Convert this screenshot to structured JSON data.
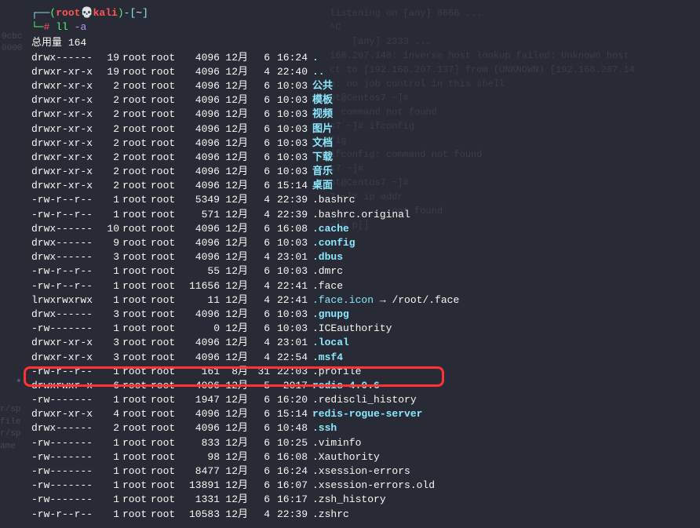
{
  "prompt": {
    "user": "root",
    "host": "kali",
    "path": "~",
    "command": "ll",
    "args": "-a"
  },
  "total_label": "总用量",
  "total_value": "164",
  "rows": [
    {
      "perms": "drwx------",
      "links": "19",
      "owner": "root",
      "group": "root",
      "size": "4096",
      "month": "12月",
      "day": "6",
      "time": "16:24",
      "name": ".",
      "type": "dir"
    },
    {
      "perms": "drwxr-xr-x",
      "links": "19",
      "owner": "root",
      "group": "root",
      "size": "4096",
      "month": "12月",
      "day": "4",
      "time": "22:40",
      "name": "..",
      "type": "dir"
    },
    {
      "perms": "drwxr-xr-x",
      "links": "2",
      "owner": "root",
      "group": "root",
      "size": "4096",
      "month": "12月",
      "day": "6",
      "time": "10:03",
      "name": "公共",
      "type": "dir"
    },
    {
      "perms": "drwxr-xr-x",
      "links": "2",
      "owner": "root",
      "group": "root",
      "size": "4096",
      "month": "12月",
      "day": "6",
      "time": "10:03",
      "name": "模板",
      "type": "dir"
    },
    {
      "perms": "drwxr-xr-x",
      "links": "2",
      "owner": "root",
      "group": "root",
      "size": "4096",
      "month": "12月",
      "day": "6",
      "time": "10:03",
      "name": "视频",
      "type": "dir"
    },
    {
      "perms": "drwxr-xr-x",
      "links": "2",
      "owner": "root",
      "group": "root",
      "size": "4096",
      "month": "12月",
      "day": "6",
      "time": "10:03",
      "name": "图片",
      "type": "dir"
    },
    {
      "perms": "drwxr-xr-x",
      "links": "2",
      "owner": "root",
      "group": "root",
      "size": "4096",
      "month": "12月",
      "day": "6",
      "time": "10:03",
      "name": "文档",
      "type": "dir"
    },
    {
      "perms": "drwxr-xr-x",
      "links": "2",
      "owner": "root",
      "group": "root",
      "size": "4096",
      "month": "12月",
      "day": "6",
      "time": "10:03",
      "name": "下载",
      "type": "dir"
    },
    {
      "perms": "drwxr-xr-x",
      "links": "2",
      "owner": "root",
      "group": "root",
      "size": "4096",
      "month": "12月",
      "day": "6",
      "time": "10:03",
      "name": "音乐",
      "type": "dir"
    },
    {
      "perms": "drwxr-xr-x",
      "links": "2",
      "owner": "root",
      "group": "root",
      "size": "4096",
      "month": "12月",
      "day": "6",
      "time": "15:14",
      "name": "桌面",
      "type": "dir"
    },
    {
      "perms": "-rw-r--r--",
      "links": "1",
      "owner": "root",
      "group": "root",
      "size": "5349",
      "month": "12月",
      "day": "4",
      "time": "22:39",
      "name": ".bashrc",
      "type": "file"
    },
    {
      "perms": "-rw-r--r--",
      "links": "1",
      "owner": "root",
      "group": "root",
      "size": "571",
      "month": "12月",
      "day": "4",
      "time": "22:39",
      "name": ".bashrc.original",
      "type": "file"
    },
    {
      "perms": "drwx------",
      "links": "10",
      "owner": "root",
      "group": "root",
      "size": "4096",
      "month": "12月",
      "day": "6",
      "time": "16:08",
      "name": ".cache",
      "type": "dir"
    },
    {
      "perms": "drwx------",
      "links": "9",
      "owner": "root",
      "group": "root",
      "size": "4096",
      "month": "12月",
      "day": "6",
      "time": "10:03",
      "name": ".config",
      "type": "dir"
    },
    {
      "perms": "drwx------",
      "links": "3",
      "owner": "root",
      "group": "root",
      "size": "4096",
      "month": "12月",
      "day": "4",
      "time": "23:01",
      "name": ".dbus",
      "type": "dir"
    },
    {
      "perms": "-rw-r--r--",
      "links": "1",
      "owner": "root",
      "group": "root",
      "size": "55",
      "month": "12月",
      "day": "6",
      "time": "10:03",
      "name": ".dmrc",
      "type": "file"
    },
    {
      "perms": "-rw-r--r--",
      "links": "1",
      "owner": "root",
      "group": "root",
      "size": "11656",
      "month": "12月",
      "day": "4",
      "time": "22:41",
      "name": ".face",
      "type": "file"
    },
    {
      "perms": "lrwxrwxrwx",
      "links": "1",
      "owner": "root",
      "group": "root",
      "size": "11",
      "month": "12月",
      "day": "4",
      "time": "22:41",
      "name": ".face.icon",
      "type": "link",
      "target": "/root/.face"
    },
    {
      "perms": "drwx------",
      "links": "3",
      "owner": "root",
      "group": "root",
      "size": "4096",
      "month": "12月",
      "day": "6",
      "time": "10:03",
      "name": ".gnupg",
      "type": "dir"
    },
    {
      "perms": "-rw-------",
      "links": "1",
      "owner": "root",
      "group": "root",
      "size": "0",
      "month": "12月",
      "day": "6",
      "time": "10:03",
      "name": ".ICEauthority",
      "type": "file"
    },
    {
      "perms": "drwxr-xr-x",
      "links": "3",
      "owner": "root",
      "group": "root",
      "size": "4096",
      "month": "12月",
      "day": "4",
      "time": "23:01",
      "name": ".local",
      "type": "dir"
    },
    {
      "perms": "drwxr-xr-x",
      "links": "3",
      "owner": "root",
      "group": "root",
      "size": "4096",
      "month": "12月",
      "day": "4",
      "time": "22:54",
      "name": ".msf4",
      "type": "dir"
    },
    {
      "perms": "-rw-r--r--",
      "links": "1",
      "owner": "root",
      "group": "root",
      "size": "161",
      "month": "8月",
      "day": "31",
      "time": "22:03",
      "name": ".profile",
      "type": "file"
    },
    {
      "perms": "drwxrwxr-x",
      "links": "6",
      "owner": "root",
      "group": "root",
      "size": "4096",
      "month": "12月",
      "day": "5",
      "time": "2017",
      "name": "redis-4.0.6",
      "type": "dir"
    },
    {
      "perms": "-rw-------",
      "links": "1",
      "owner": "root",
      "group": "root",
      "size": "1947",
      "month": "12月",
      "day": "6",
      "time": "16:20",
      "name": ".rediscli_history",
      "type": "file"
    },
    {
      "perms": "drwxr-xr-x",
      "links": "4",
      "owner": "root",
      "group": "root",
      "size": "4096",
      "month": "12月",
      "day": "6",
      "time": "15:14",
      "name": "redis-rogue-server",
      "type": "dir"
    },
    {
      "perms": "drwx------",
      "links": "2",
      "owner": "root",
      "group": "root",
      "size": "4096",
      "month": "12月",
      "day": "6",
      "time": "10:48",
      "name": ".ssh",
      "type": "dir"
    },
    {
      "perms": "-rw-------",
      "links": "1",
      "owner": "root",
      "group": "root",
      "size": "833",
      "month": "12月",
      "day": "6",
      "time": "10:25",
      "name": ".viminfo",
      "type": "file"
    },
    {
      "perms": "-rw-------",
      "links": "1",
      "owner": "root",
      "group": "root",
      "size": "98",
      "month": "12月",
      "day": "6",
      "time": "16:08",
      "name": ".Xauthority",
      "type": "file"
    },
    {
      "perms": "-rw-------",
      "links": "1",
      "owner": "root",
      "group": "root",
      "size": "8477",
      "month": "12月",
      "day": "6",
      "time": "16:24",
      "name": ".xsession-errors",
      "type": "file"
    },
    {
      "perms": "-rw-------",
      "links": "1",
      "owner": "root",
      "group": "root",
      "size": "13891",
      "month": "12月",
      "day": "6",
      "time": "16:07",
      "name": ".xsession-errors.old",
      "type": "file"
    },
    {
      "perms": "-rw-------",
      "links": "1",
      "owner": "root",
      "group": "root",
      "size": "1331",
      "month": "12月",
      "day": "6",
      "time": "16:17",
      "name": ".zsh_history",
      "type": "file"
    },
    {
      "perms": "-rw-r--r--",
      "links": "1",
      "owner": "root",
      "group": "root",
      "size": "10583",
      "month": "12月",
      "day": "4",
      "time": "22:39",
      "name": ".zshrc",
      "type": "file"
    }
  ],
  "gutter": [
    "9cbc",
    "0000"
  ],
  "sidelabels": [
    "r/sp",
    "file",
    "r/sp",
    "",
    "ame"
  ],
  "star": "*",
  "bg_lines": [
    "",
    "listening on [any] 6666 ...",
    "^C",
    "",
    "",
    "",
    "",
    "",
    "",
    "",
    "",
    "    [any] 2333 ...",
    "168.207.140: inverse host lookup failed: Unknown host",
    "ct to [192.168.207.137] from (UNKNOWN) [192.168.207.14",
    "h: no job control in this shell",
    "ot@Centos7 ~]#",
    "",
    ": command not found",
    "s7 ~]# ifconfig",
    "fig",
    "ifconfig: command not found",
    "s7 ~]#",
    "",
    "",
    "ot@Centos7 ~]#",
    "",
    "7 ~]# ip addr",
    "",
    "           not found",
    "~]# p[]"
  ]
}
